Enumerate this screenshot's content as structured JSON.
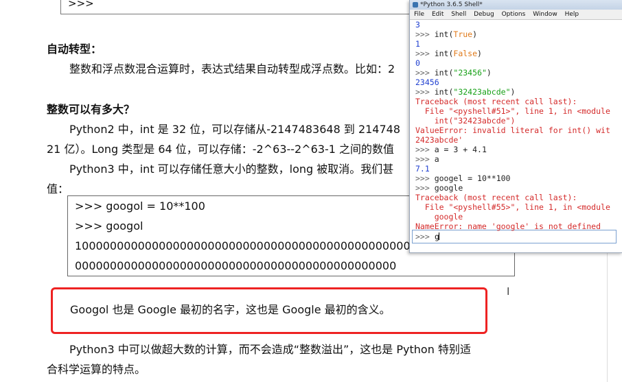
{
  "doc": {
    "top_box_text": ">>>",
    "section1_heading": "自动转型：",
    "section1_text": "整数和浮点数混合运算时，表达式结果自动转型成浮点数。比如：2",
    "section2_heading": "整数可以有多大？",
    "para1_line1": "Python2 中，int 是 32 位，可以存储从-2147483648 到 214748",
    "para1_line2": "21 亿）。Long 类型是 64 位，可以存储：-2^63--2^63-1 之间的数值",
    "para2_line1": "Python3 中，int 可以存储任意大小的整数，long 被取消。我们甚",
    "para2_line2": "值：",
    "code_lines": [
      ">>> googol = 10**100",
      ">>> googol",
      "1000000000000000000000000000000000000000000000000000",
      "0000000000000000000000000000000000000000000000"
    ],
    "highlight_text": "Googol 也是 Google 最初的名字，这也是 Google 最初的含义。",
    "para3_line1": "Python3 中可以做超大数的计算，而不会造成“整数溢出”，这也是 Python 特别适",
    "para3_line2": "合科学运算的特点。"
  },
  "shell": {
    "title": "*Python 3.6.5 Shell*",
    "menu": [
      "File",
      "Edit",
      "Shell",
      "Debug",
      "Options",
      "Window",
      "Help"
    ],
    "lines": [
      {
        "segments": [
          {
            "t": "3",
            "c": "blue"
          }
        ]
      },
      {
        "segments": [
          {
            "t": ">>> ",
            "c": "prompt"
          },
          {
            "t": "int(",
            "c": "plain"
          },
          {
            "t": "True",
            "c": "orange"
          },
          {
            "t": ")",
            "c": "plain"
          }
        ]
      },
      {
        "segments": [
          {
            "t": "1",
            "c": "blue"
          }
        ]
      },
      {
        "segments": [
          {
            "t": ">>> ",
            "c": "prompt"
          },
          {
            "t": "int(",
            "c": "plain"
          },
          {
            "t": "False",
            "c": "orange"
          },
          {
            "t": ")",
            "c": "plain"
          }
        ]
      },
      {
        "segments": [
          {
            "t": "0",
            "c": "blue"
          }
        ]
      },
      {
        "segments": [
          {
            "t": ">>> ",
            "c": "prompt"
          },
          {
            "t": "int(",
            "c": "plain"
          },
          {
            "t": "\"23456\"",
            "c": "green"
          },
          {
            "t": ")",
            "c": "plain"
          }
        ]
      },
      {
        "segments": [
          {
            "t": "23456",
            "c": "blue"
          }
        ]
      },
      {
        "segments": [
          {
            "t": ">>> ",
            "c": "prompt"
          },
          {
            "t": "int(",
            "c": "plain"
          },
          {
            "t": "\"32423abcde\"",
            "c": "green"
          },
          {
            "t": ")",
            "c": "plain"
          }
        ]
      },
      {
        "segments": [
          {
            "t": "Traceback (most recent call last):",
            "c": "red"
          }
        ]
      },
      {
        "segments": [
          {
            "t": "  File \"<pyshell#51>\", line 1, in <module",
            "c": "red"
          }
        ]
      },
      {
        "segments": [
          {
            "t": "    int(\"32423abcde\")",
            "c": "red"
          }
        ]
      },
      {
        "segments": [
          {
            "t": "ValueError: invalid literal for int() wit",
            "c": "red"
          }
        ]
      },
      {
        "segments": [
          {
            "t": "2423abcde'",
            "c": "red"
          }
        ]
      },
      {
        "segments": [
          {
            "t": ">>> ",
            "c": "prompt"
          },
          {
            "t": "a = 3 + 4.1",
            "c": "plain"
          }
        ]
      },
      {
        "segments": [
          {
            "t": ">>> ",
            "c": "prompt"
          },
          {
            "t": "a",
            "c": "plain"
          }
        ]
      },
      {
        "segments": [
          {
            "t": "7.1",
            "c": "blue"
          }
        ]
      },
      {
        "segments": [
          {
            "t": ">>> ",
            "c": "prompt"
          },
          {
            "t": "googel = 10**100",
            "c": "plain"
          }
        ]
      },
      {
        "segments": [
          {
            "t": ">>> ",
            "c": "prompt"
          },
          {
            "t": "google",
            "c": "plain"
          }
        ]
      },
      {
        "segments": [
          {
            "t": "Traceback (most recent call last):",
            "c": "red"
          }
        ]
      },
      {
        "segments": [
          {
            "t": "  File \"<pyshell#55>\", line 1, in <module",
            "c": "red"
          }
        ]
      },
      {
        "segments": [
          {
            "t": "    google",
            "c": "red"
          }
        ]
      },
      {
        "segments": [
          {
            "t": "NameError: name 'google' is not defined",
            "c": "red"
          }
        ]
      }
    ],
    "input_prompt": ">>> ",
    "input_value": "g"
  },
  "colors": {
    "highlight_border": "#ee2222",
    "shell_blue": "#1f3fd0",
    "shell_red": "#d42a2a",
    "shell_green": "#17a017",
    "shell_orange": "#e07a1a"
  },
  "icons": {
    "shell_app_icon": "python-icon",
    "text_cursor": "i-beam-cursor-icon"
  }
}
